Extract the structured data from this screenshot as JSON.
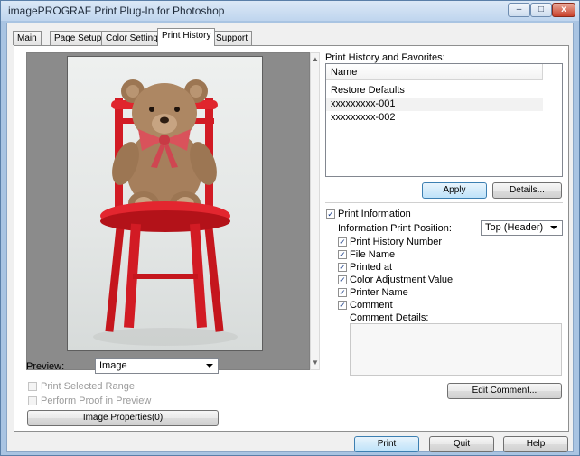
{
  "window": {
    "title": "imagePROGRAF Print Plug-In for Photoshop",
    "minimize": "–",
    "maximize": "□",
    "close": "x"
  },
  "tabs": [
    {
      "label": "Main"
    },
    {
      "label": "Page Setup"
    },
    {
      "label": "Color Settings"
    },
    {
      "label": "Print History"
    },
    {
      "label": "Support"
    }
  ],
  "preview": {
    "label": "Preview:",
    "value": "Image",
    "print_selected_range": "Print Selected Range",
    "perform_proof": "Perform Proof in Preview",
    "image_properties_button": "Image Properties(0)",
    "scroll_up": "▲",
    "scroll_down": "▼"
  },
  "history": {
    "label": "Print History and Favorites:",
    "column_header": "Name",
    "items": [
      {
        "name": "Restore Defaults"
      },
      {
        "name": "xxxxxxxxx-001"
      },
      {
        "name": "xxxxxxxxx-002"
      }
    ],
    "apply_button": "Apply",
    "details_button": "Details..."
  },
  "print_info": {
    "label": "Print Information",
    "checked": true,
    "position_label": "Information Print Position:",
    "position_value": "Top (Header)",
    "options": [
      {
        "label": "Print History Number",
        "checked": true
      },
      {
        "label": "File Name",
        "checked": true
      },
      {
        "label": "Printed at",
        "checked": true
      },
      {
        "label": "Color Adjustment Value",
        "checked": true
      },
      {
        "label": "Printer Name",
        "checked": true
      },
      {
        "label": "Comment",
        "checked": true
      }
    ],
    "comment_details_label": "Comment Details:",
    "edit_comment_button": "Edit Comment..."
  },
  "footer": {
    "print_button": "Print",
    "quit_button": "Quit",
    "help_button": "Help"
  },
  "check_mark": "✓"
}
